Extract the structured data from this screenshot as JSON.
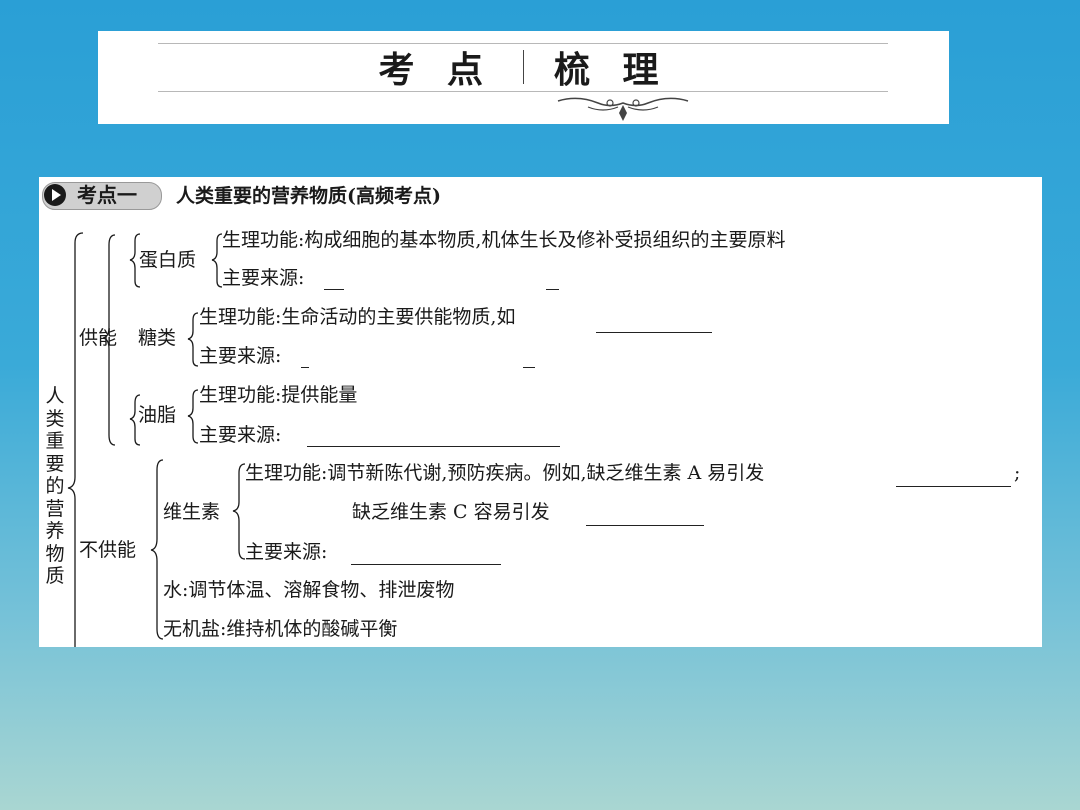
{
  "header": {
    "title_left": "考 点",
    "title_right": "梳 理"
  },
  "doc": {
    "section_tag": "考点一",
    "section_title": "人类重要的营养物质(高频考点)",
    "root_label": "人类重要的营养物质",
    "branches": {
      "energy": "供能",
      "non_energy": "不供能"
    },
    "protein": {
      "name": "蛋白质",
      "function": "生理功能:构成细胞的基本物质,机体生长及修补受损组织的主要原料",
      "source": "主要来源:"
    },
    "sugar": {
      "name": "糖类",
      "function": "生理功能:生命活动的主要供能物质,如",
      "source": "主要来源:"
    },
    "fat": {
      "name": "油脂",
      "function": "生理功能:提供能量",
      "source": "主要来源:"
    },
    "vitamin": {
      "name": "维生素",
      "function": "生理功能:调节新陈代谢,预防疾病。例如,缺乏维生素 A 易引发",
      "function_end": ";",
      "function2": "缺乏维生素 C 容易引发",
      "source": "主要来源:"
    },
    "water": "水:调节体温、溶解食物、排泄废物",
    "mineral": "无机盐:维持机体的酸碱平衡"
  }
}
